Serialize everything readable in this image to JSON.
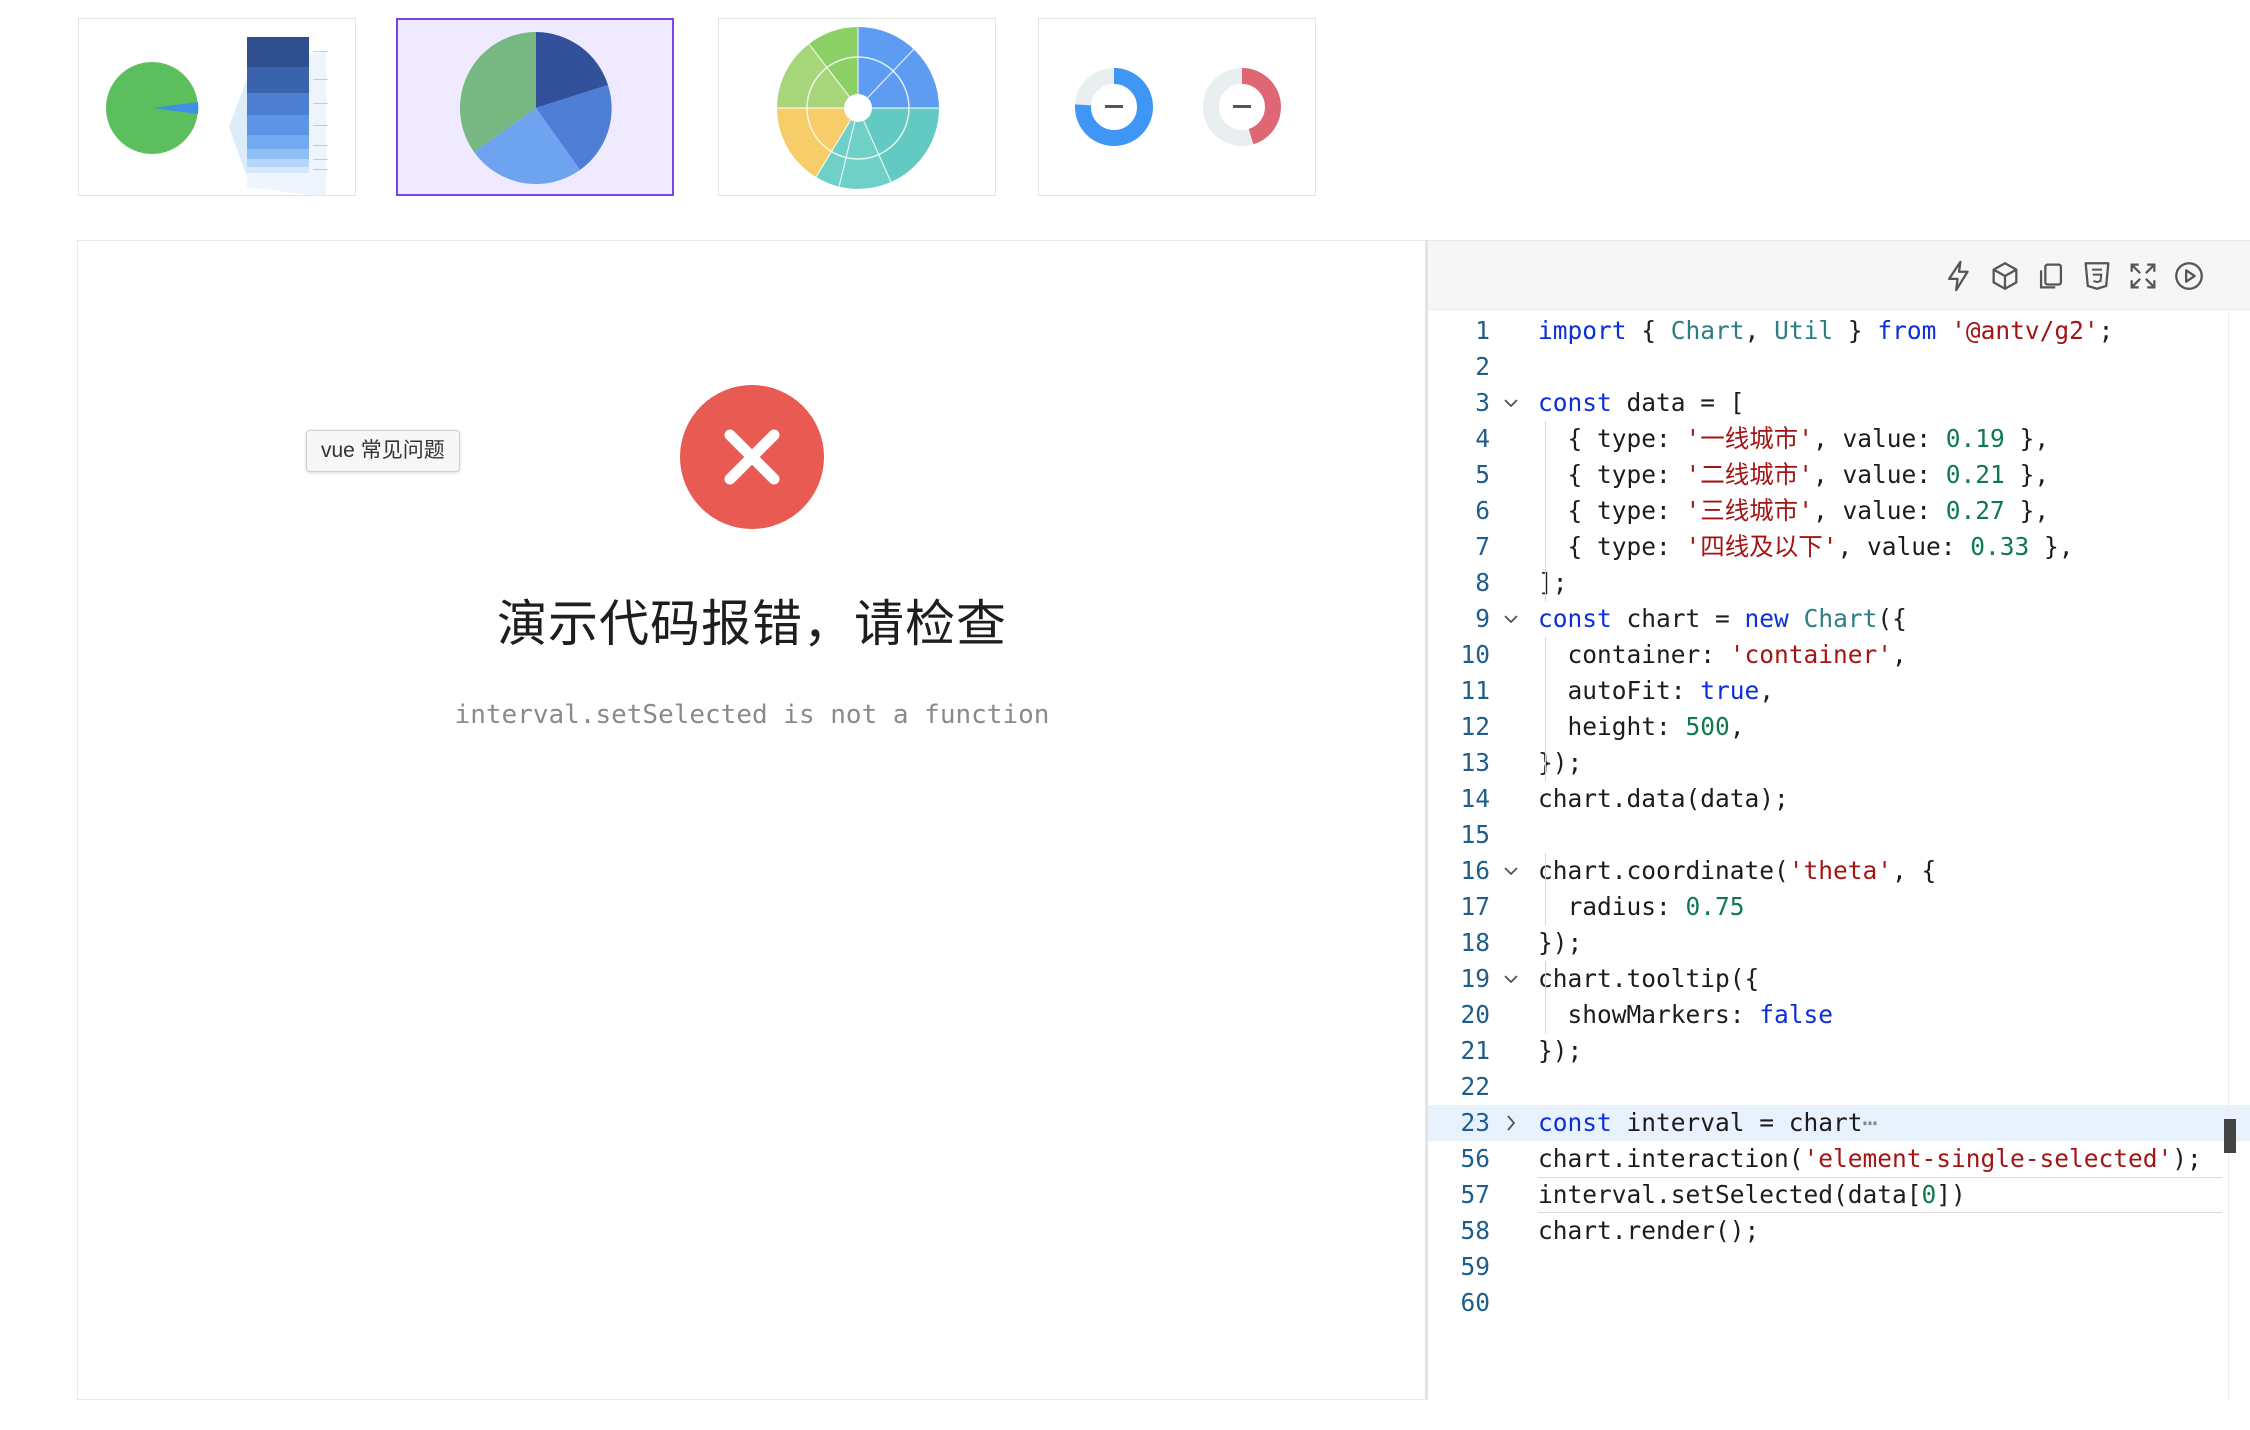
{
  "thumbnails": [
    {
      "name": "funnel-pie-thumbnail",
      "active": false
    },
    {
      "name": "pie-thumbnail",
      "active": true
    },
    {
      "name": "sunburst-thumbnail",
      "active": false
    },
    {
      "name": "donut-progress-thumbnail",
      "active": false
    }
  ],
  "preview": {
    "error_title": "演示代码报错，请检查",
    "error_message": "interval.setSelected is not a function",
    "tooltip": "vue 常见问题",
    "error_color": "#e85a52"
  },
  "editor": {
    "toolbar_icons": [
      "lightning-icon",
      "cube-icon",
      "copy-icon",
      "html5-icon",
      "fullscreen-icon",
      "play-icon"
    ],
    "lines": [
      {
        "n": "1",
        "fold": "",
        "html": "<span class='kw'>import</span> { <span class='ty'>Chart</span>, <span class='ty'>Util</span> } <span class='kw'>from</span> <span class='str'>'@antv/g2'</span>;"
      },
      {
        "n": "2",
        "fold": "",
        "html": ""
      },
      {
        "n": "3",
        "fold": "open",
        "html": "<span class='kw'>const</span> data = ["
      },
      {
        "n": "4",
        "fold": "",
        "html": "  { type: <span class='str'>'一线城市'</span>, value: <span class='num'>0.19</span> },"
      },
      {
        "n": "5",
        "fold": "",
        "html": "  { type: <span class='str'>'二线城市'</span>, value: <span class='num'>0.21</span> },"
      },
      {
        "n": "6",
        "fold": "",
        "html": "  { type: <span class='str'>'三线城市'</span>, value: <span class='num'>0.27</span> },"
      },
      {
        "n": "7",
        "fold": "",
        "html": "  { type: <span class='str'>'四线及以下'</span>, value: <span class='num'>0.33</span> },"
      },
      {
        "n": "8",
        "fold": "",
        "html": "];"
      },
      {
        "n": "9",
        "fold": "open",
        "html": "<span class='kw'>const</span> chart = <span class='kw'>new</span> <span class='ty'>Chart</span>({"
      },
      {
        "n": "10",
        "fold": "",
        "html": "  container: <span class='str'>'container'</span>,"
      },
      {
        "n": "11",
        "fold": "",
        "html": "  autoFit: <span class='kw'>true</span>,"
      },
      {
        "n": "12",
        "fold": "",
        "html": "  height: <span class='num'>500</span>,"
      },
      {
        "n": "13",
        "fold": "",
        "html": "});"
      },
      {
        "n": "14",
        "fold": "",
        "html": "chart.data(data);"
      },
      {
        "n": "15",
        "fold": "",
        "html": ""
      },
      {
        "n": "16",
        "fold": "open",
        "html": "chart.coordinate(<span class='str'>'theta'</span>, {"
      },
      {
        "n": "17",
        "fold": "",
        "html": "  radius: <span class='num'>0.75</span>"
      },
      {
        "n": "18",
        "fold": "",
        "html": "});"
      },
      {
        "n": "19",
        "fold": "open",
        "html": "chart.tooltip({"
      },
      {
        "n": "20",
        "fold": "",
        "html": "  showMarkers: <span class='kw'>false</span>"
      },
      {
        "n": "21",
        "fold": "",
        "html": "});"
      },
      {
        "n": "22",
        "fold": "",
        "html": ""
      },
      {
        "n": "23",
        "fold": "closed",
        "html": "<span class='kw'>const</span> interval = chart<span style='color:#888'>⋯</span>"
      },
      {
        "n": "56",
        "fold": "",
        "html": "chart.interaction(<span class='str'>'element-single-selected'</span>);"
      },
      {
        "n": "57",
        "fold": "",
        "html": "interval.setSelected(data[<span class='num'>0</span>])"
      },
      {
        "n": "58",
        "fold": "",
        "html": "chart.render();"
      },
      {
        "n": "59",
        "fold": "",
        "html": ""
      },
      {
        "n": "60",
        "fold": "",
        "html": ""
      }
    ]
  }
}
